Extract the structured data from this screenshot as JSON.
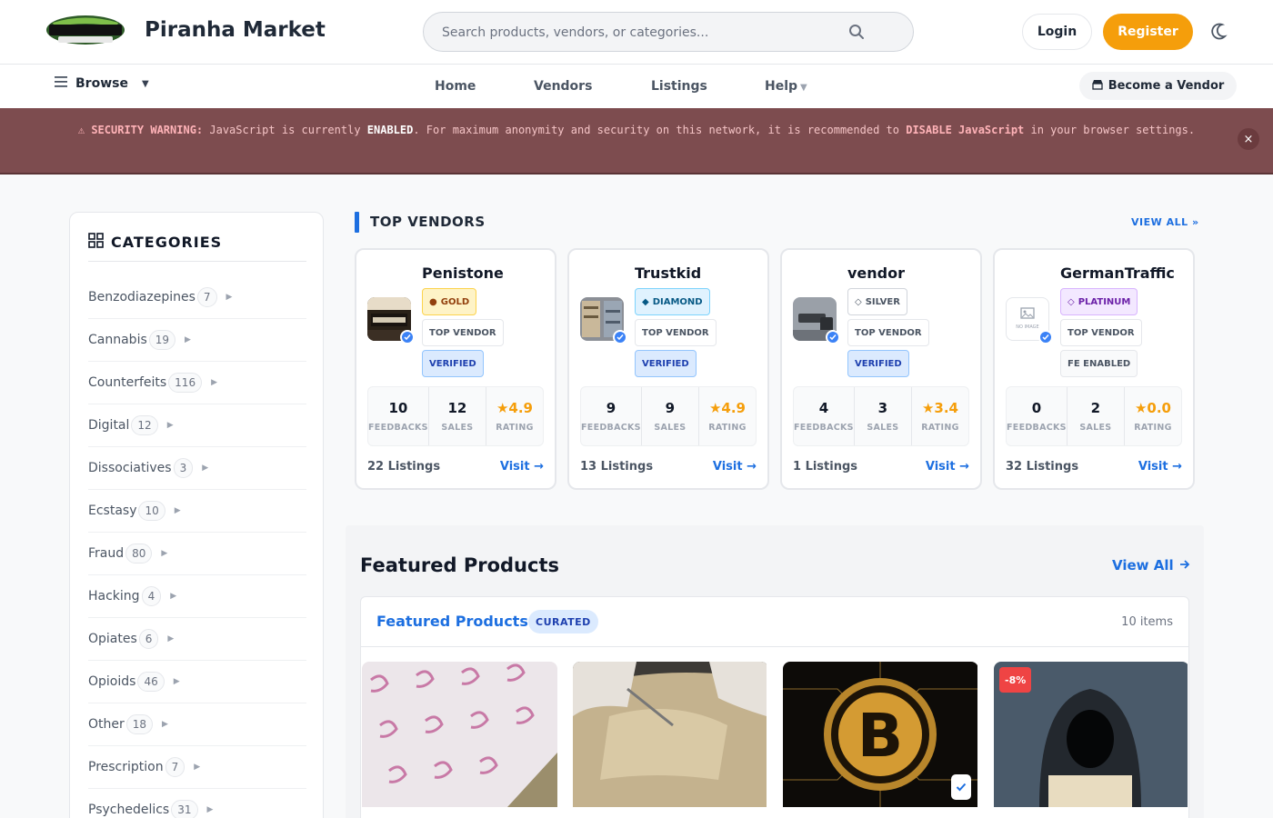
{
  "header": {
    "logo_text": "PIRANHA MARKET",
    "brand": "Piranha Market",
    "search_placeholder": "Search products, vendors, or categories...",
    "login": "Login",
    "register": "Register"
  },
  "nav": {
    "browse": "Browse",
    "links": [
      "Home",
      "Vendors",
      "Listings",
      "Help"
    ],
    "become_vendor": "Become a Vendor"
  },
  "warning": {
    "label": "⚠ SECURITY WARNING:",
    "part1": " JavaScript is currently ",
    "enabled": "ENABLED",
    "part2": ". For maximum anonymity and security on this network, it is recommended to ",
    "disable": "DISABLE JavaScript",
    "part3": " in your browser settings.",
    "close": "×"
  },
  "sidebar": {
    "title": "CATEGORIES",
    "categories": [
      {
        "name": "Benzodiazepines",
        "count": "7"
      },
      {
        "name": "Cannabis",
        "count": "19"
      },
      {
        "name": "Counterfeits",
        "count": "116"
      },
      {
        "name": "Digital",
        "count": "12"
      },
      {
        "name": "Dissociatives",
        "count": "3"
      },
      {
        "name": "Ecstasy",
        "count": "10"
      },
      {
        "name": "Fraud",
        "count": "80"
      },
      {
        "name": "Hacking",
        "count": "4"
      },
      {
        "name": "Opiates",
        "count": "6"
      },
      {
        "name": "Opioids",
        "count": "46"
      },
      {
        "name": "Other",
        "count": "18"
      },
      {
        "name": "Prescription",
        "count": "7"
      },
      {
        "name": "Psychedelics",
        "count": "31"
      }
    ]
  },
  "top_vendors": {
    "title": "TOP VENDORS",
    "view_all": "VIEW ALL »",
    "stat_labels": {
      "feedbacks": "FEEDBACKS",
      "sales": "SALES",
      "rating": "RATING"
    },
    "visit": "Visit →",
    "vendors": [
      {
        "name": "Penistone",
        "tier": "GOLD",
        "tier_icon": "●",
        "badges": [
          "TOP VENDOR",
          "VERIFIED"
        ],
        "feedbacks": "10",
        "sales": "12",
        "rating": "★4.9",
        "listings": "22 Listings"
      },
      {
        "name": "Trustkid",
        "tier": "DIAMOND",
        "tier_icon": "◆",
        "badges": [
          "TOP VENDOR",
          "VERIFIED"
        ],
        "feedbacks": "9",
        "sales": "9",
        "rating": "★4.9",
        "listings": "13 Listings"
      },
      {
        "name": "vendor",
        "tier": "SILVER",
        "tier_icon": "◇",
        "badges": [
          "TOP VENDOR",
          "VERIFIED"
        ],
        "feedbacks": "4",
        "sales": "3",
        "rating": "★3.4",
        "listings": "1 Listings"
      },
      {
        "name": "GermanTraffic",
        "tier": "PLATINUM",
        "tier_icon": "◇",
        "badges": [
          "TOP VENDOR",
          "FE ENABLED"
        ],
        "feedbacks": "0",
        "sales": "2",
        "rating": "★0.0",
        "listings": "32 Listings",
        "no_image": "NO IMAGE"
      }
    ]
  },
  "featured": {
    "title": "Featured Products",
    "view_all": "View All",
    "subtitle": "Featured Products",
    "curated": "CURATED",
    "count": "10 items",
    "discount": "-8%"
  },
  "colors": {
    "accent": "#1d6fe0",
    "register": "#f59e0b",
    "warning_bg": "#7d4c4f"
  }
}
